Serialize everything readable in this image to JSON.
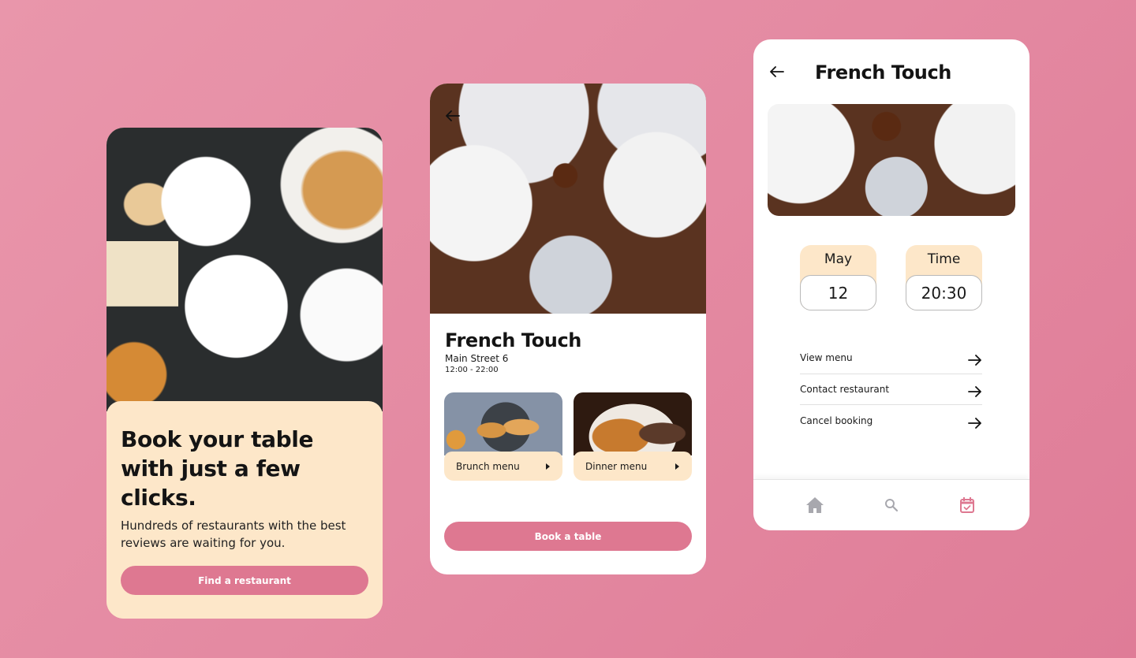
{
  "colors": {
    "background": "#e48aa2",
    "accent": "#de7891",
    "cream": "#fde7c9",
    "inactive_icon": "#a8a8ae",
    "text": "#141414"
  },
  "onboarding": {
    "headline": "Book your table with just a few clicks.",
    "subtext": "Hundreds of restaurants with the best reviews are waiting for you.",
    "cta_label": "Find a restaurant"
  },
  "restaurant": {
    "back_icon": "arrow-left-icon",
    "name": "French Touch",
    "address": "Main Street 6",
    "hours": "12:00 - 22:00",
    "menus": [
      {
        "label": "Brunch menu",
        "icon": "play-triangle-icon"
      },
      {
        "label": "Dinner menu",
        "icon": "play-triangle-icon"
      }
    ],
    "cta_label": "Book a table"
  },
  "booking": {
    "back_icon": "arrow-left-icon",
    "title": "French Touch",
    "date": {
      "label": "May",
      "value": "12"
    },
    "time": {
      "label": "Time",
      "value": "20:30"
    },
    "actions": [
      {
        "label": "View menu",
        "icon": "arrow-right-icon"
      },
      {
        "label": "Contact restaurant",
        "icon": "arrow-right-icon"
      },
      {
        "label": "Cancel booking",
        "icon": "arrow-right-icon"
      }
    ],
    "tabbar": [
      {
        "name": "home",
        "icon": "home-icon",
        "active": false
      },
      {
        "name": "search",
        "icon": "search-icon",
        "active": false
      },
      {
        "name": "bookings",
        "icon": "calendar-check-icon",
        "active": true
      }
    ]
  }
}
